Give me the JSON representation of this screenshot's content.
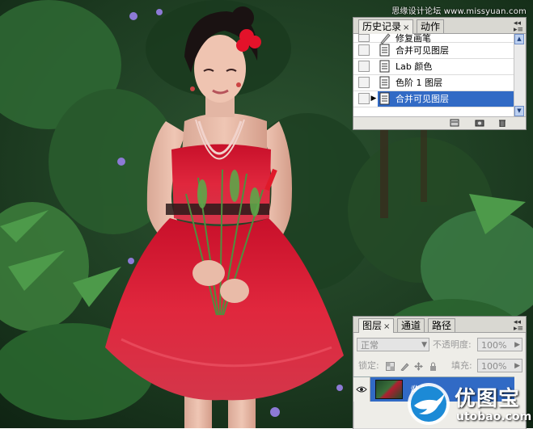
{
  "watermark": "思缘设计论坛 www.missyuan.com",
  "history_panel": {
    "tabs": [
      {
        "label": "历史记录",
        "close": "×"
      },
      {
        "label": "动作"
      }
    ],
    "items": [
      {
        "label": "修复画笔",
        "tool": "brush-icon"
      },
      {
        "label": "合并可见图层",
        "tool": "document-icon"
      },
      {
        "label": "Lab 颜色",
        "tool": "document-icon"
      },
      {
        "label": "色阶 1 图层",
        "tool": "document-icon"
      },
      {
        "label": "合并可见图层",
        "tool": "document-icon",
        "selected": true
      }
    ],
    "footer_icons": [
      "new-document-from-state-icon",
      "camera-snapshot-icon",
      "trash-icon"
    ]
  },
  "layers_panel": {
    "tabs": [
      {
        "label": "图层",
        "close": "×"
      },
      {
        "label": "通道"
      },
      {
        "label": "路径"
      }
    ],
    "blend_mode": "正常",
    "opacity_label": "不透明度:",
    "opacity_value": "100%",
    "lock_label": "锁定:",
    "fill_label": "填充:",
    "fill_value": "100%",
    "layer": {
      "name": "背景",
      "selected_color": "#316ac5"
    }
  },
  "logo": {
    "cn": "优图宝",
    "en": "utobao.com"
  },
  "colors": {
    "panel_bg": "#eeede8",
    "selection": "#316ac5",
    "dress_red": "#d8192f",
    "foliage": "#1f4a26"
  }
}
